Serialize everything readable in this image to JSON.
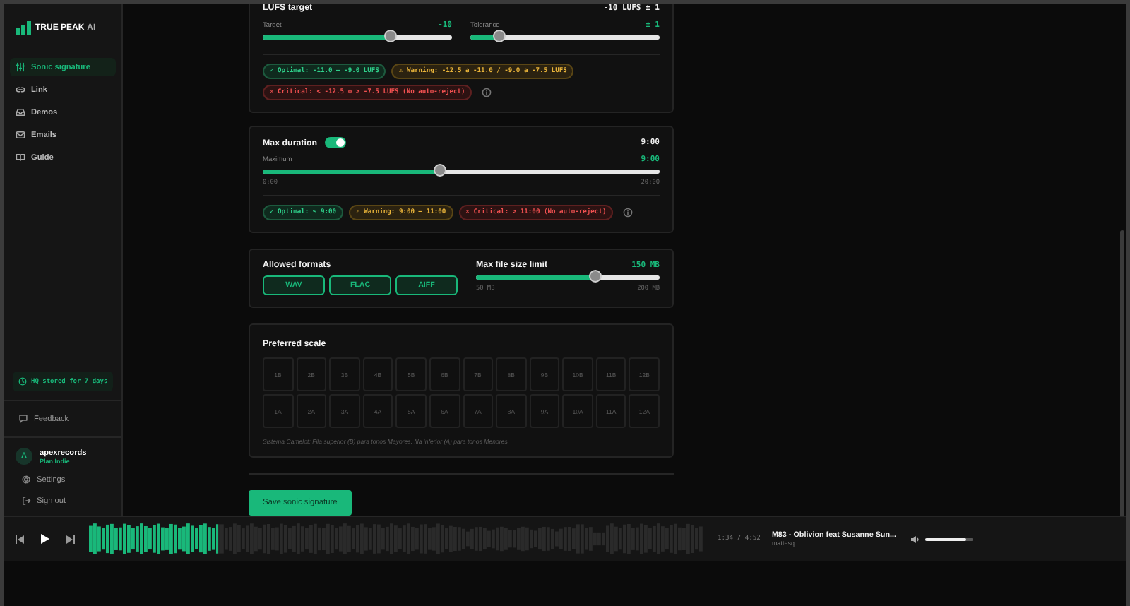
{
  "brand": {
    "name": "TRUE PEAK",
    "suffix": "AI"
  },
  "nav": [
    {
      "label": "Sonic signature",
      "kind": "sliders",
      "selected": true
    },
    {
      "label": "Link",
      "kind": "link",
      "selected": false
    },
    {
      "label": "Demos",
      "kind": "inbox",
      "selected": false
    },
    {
      "label": "Emails",
      "kind": "mail",
      "selected": false
    },
    {
      "label": "Guide",
      "kind": "book",
      "selected": false
    }
  ],
  "storage_note": "HQ stored for 7 days",
  "feedback": "Feedback",
  "user": {
    "initial": "A",
    "name": "apexrecords",
    "plan": "Plan Indie"
  },
  "account_links": [
    {
      "label": "Settings",
      "kind": "gear"
    },
    {
      "label": "Sign out",
      "kind": "exit"
    }
  ],
  "lufs": {
    "title": "LUFS target",
    "summary": "-10 LUFS ± 1",
    "sliders": [
      {
        "label": "Target",
        "reading": "-10",
        "level": 0.68
      },
      {
        "label": "Tolerance",
        "reading": "± 1",
        "level": 0.16
      }
    ],
    "pills": [
      {
        "kind": "optimal",
        "text": "✓ Optimal: -11.0 — -9.0 LUFS"
      },
      {
        "kind": "warning",
        "text": "⚠ Warning: -12.5 a -11.0 / -9.0 a -7.5 LUFS"
      },
      {
        "kind": "critical",
        "text": "✕ Critical: < -12.5 o > -7.5 LUFS (No auto-reject)"
      }
    ]
  },
  "duration": {
    "title": "Max duration",
    "on": true,
    "summary": "9:00",
    "slider": {
      "label": "Maximum",
      "reading": "9:00",
      "level": 0.45,
      "min": "0:00",
      "max": "20:00"
    },
    "pills": [
      {
        "kind": "optimal",
        "text": "✓ Optimal: ≤ 9:00"
      },
      {
        "kind": "warning",
        "text": "⚠ Warning: 9:00 — 11:00"
      },
      {
        "kind": "critical",
        "text": "✕ Critical: > 11:00 (No auto-reject)"
      }
    ]
  },
  "formats": {
    "title": "Allowed formats",
    "options": [
      {
        "label": "WAV",
        "selected": true
      },
      {
        "label": "FLAC",
        "selected": true
      },
      {
        "label": "AIFF",
        "selected": true
      }
    ]
  },
  "file_size": {
    "title": "Max file size limit",
    "reading": "150 MB",
    "level": 0.65,
    "min": "50 MB",
    "max": "200 MB"
  },
  "scale": {
    "title": "Preferred scale",
    "rows": [
      [
        {
          "label": "1B",
          "selected": false
        },
        {
          "label": "2B",
          "selected": false
        },
        {
          "label": "3B",
          "selected": false
        },
        {
          "label": "4B",
          "selected": false
        },
        {
          "label": "5B",
          "selected": false
        },
        {
          "label": "6B",
          "selected": false
        },
        {
          "label": "7B",
          "selected": false
        },
        {
          "label": "8B",
          "selected": false
        },
        {
          "label": "9B",
          "selected": false
        },
        {
          "label": "10B",
          "selected": false
        },
        {
          "label": "11B",
          "selected": false
        },
        {
          "label": "12B",
          "selected": false
        }
      ],
      [
        {
          "label": "1A",
          "selected": false
        },
        {
          "label": "2A",
          "selected": false
        },
        {
          "label": "3A",
          "selected": false
        },
        {
          "label": "4A",
          "selected": false
        },
        {
          "label": "5A",
          "selected": false
        },
        {
          "label": "6A",
          "selected": false
        },
        {
          "label": "7A",
          "selected": false
        },
        {
          "label": "8A",
          "selected": false
        },
        {
          "label": "9A",
          "selected": false
        },
        {
          "label": "10A",
          "selected": false
        },
        {
          "label": "11A",
          "selected": false
        },
        {
          "label": "12A",
          "selected": false
        }
      ]
    ],
    "note": "Sistema Camelot: Fila superior (B) para tonos Mayores, fila inferior (A) para tonos Menores."
  },
  "save_button": "Save sonic signature",
  "player": {
    "progress": {
      "level": 0.21
    },
    "time": "1:34 / 4:52",
    "track": "M83 - Oblivion feat Susanne Sun...",
    "artist": "mattesq",
    "volume": {
      "level": 0.85
    }
  }
}
